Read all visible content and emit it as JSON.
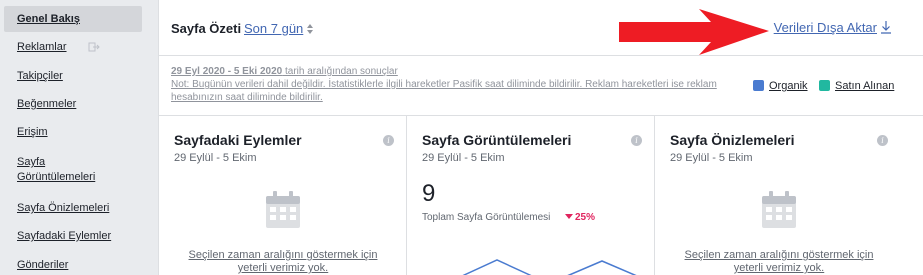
{
  "sidebar": {
    "items": [
      {
        "label": "Genel Bakış",
        "active": true
      },
      {
        "label": "Reklamlar",
        "locked": true
      },
      {
        "label": "Takipçiler"
      },
      {
        "label": "Beğenmeler"
      },
      {
        "label": "Erişim"
      },
      {
        "label": "Sayfa Görüntülemeleri"
      },
      {
        "label": "Sayfa Önizlemeleri"
      },
      {
        "label": "Sayfadaki Eylemler"
      },
      {
        "label": "Gönderiler"
      }
    ]
  },
  "header": {
    "title": "Sayfa Özeti",
    "period": "Son 7 gün",
    "export_label": "Verileri Dışa Aktar"
  },
  "notice": {
    "range_bold": "29 Eyl 2020 - 5 Eki 2020",
    "range_rest": " tarih aralığından sonuçlar",
    "note": "Not: Bugünün verileri dahil değildir. İstatistiklerle ilgili hareketler Pasifik saat diliminde bildirilir. Reklam hareketleri ise reklam hesabınızın saat diliminde bildirilir."
  },
  "legend": {
    "items": [
      {
        "label": "Organik",
        "color": "#4a7bd0"
      },
      {
        "label": "Satın Alınan",
        "color": "#21b8a0"
      }
    ]
  },
  "cards": [
    {
      "title": "Sayfadaki Eylemler",
      "subtitle": "29 Eylül - 5 Ekim",
      "empty_message": "Seçilen zaman aralığını göstermek için yeterli verimiz yok."
    },
    {
      "title": "Sayfa Görüntülemeleri",
      "subtitle": "29 Eylül - 5 Ekim",
      "value": "9",
      "metric_label": "Toplam Sayfa Görüntülemesi",
      "trend": "25%",
      "trend_direction": "down"
    },
    {
      "title": "Sayfa Önizlemeleri",
      "subtitle": "29 Eylül - 5 Ekim",
      "empty_message": "Seçilen zaman aralığını göstermek için yeterli verimiz yok."
    }
  ],
  "colors": {
    "link": "#4267b2",
    "annotation_arrow": "#ee1c24",
    "chart_line": "#4a7bd0",
    "trend_down": "#e0245e"
  }
}
